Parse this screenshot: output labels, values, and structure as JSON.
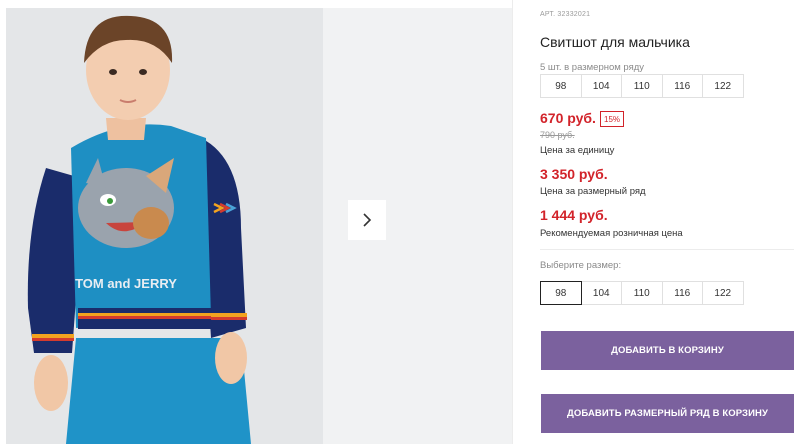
{
  "gallery": {
    "next_arrow_icon": "chevron-right-icon",
    "main_photo": "boy-sweatshirt-tom-and-jerry",
    "print_text": "TOM and JERRY"
  },
  "product": {
    "article": "АРТ. 32332021",
    "title": "Свитшот для мальчика",
    "row_caption": "5 шт. в размерном ряду",
    "row_sizes": [
      "98",
      "104",
      "110",
      "116",
      "122"
    ],
    "price": "670 руб.",
    "discount": "15%",
    "old_price": "790 руб.",
    "unit_caption": "Цена за единицу",
    "row_price": "3 350 руб.",
    "row_price_caption": "Цена за размерный ряд",
    "rrp_price": "1 444 руб.",
    "rrp_caption": "Рекомендуемая розничная цена",
    "choose_size_label": "Выберите размер:",
    "size_options": [
      "98",
      "104",
      "110",
      "116",
      "122"
    ],
    "selected_size": "98",
    "accent_color": "#7b619e",
    "price_color": "#d2232a"
  },
  "actions": {
    "add_to_cart": "ДОБАВИТЬ В КОРЗИНУ",
    "add_row_to_cart": "ДОБАВИТЬ РАЗМЕРНЫЙ РЯД В КОРЗИНУ"
  }
}
